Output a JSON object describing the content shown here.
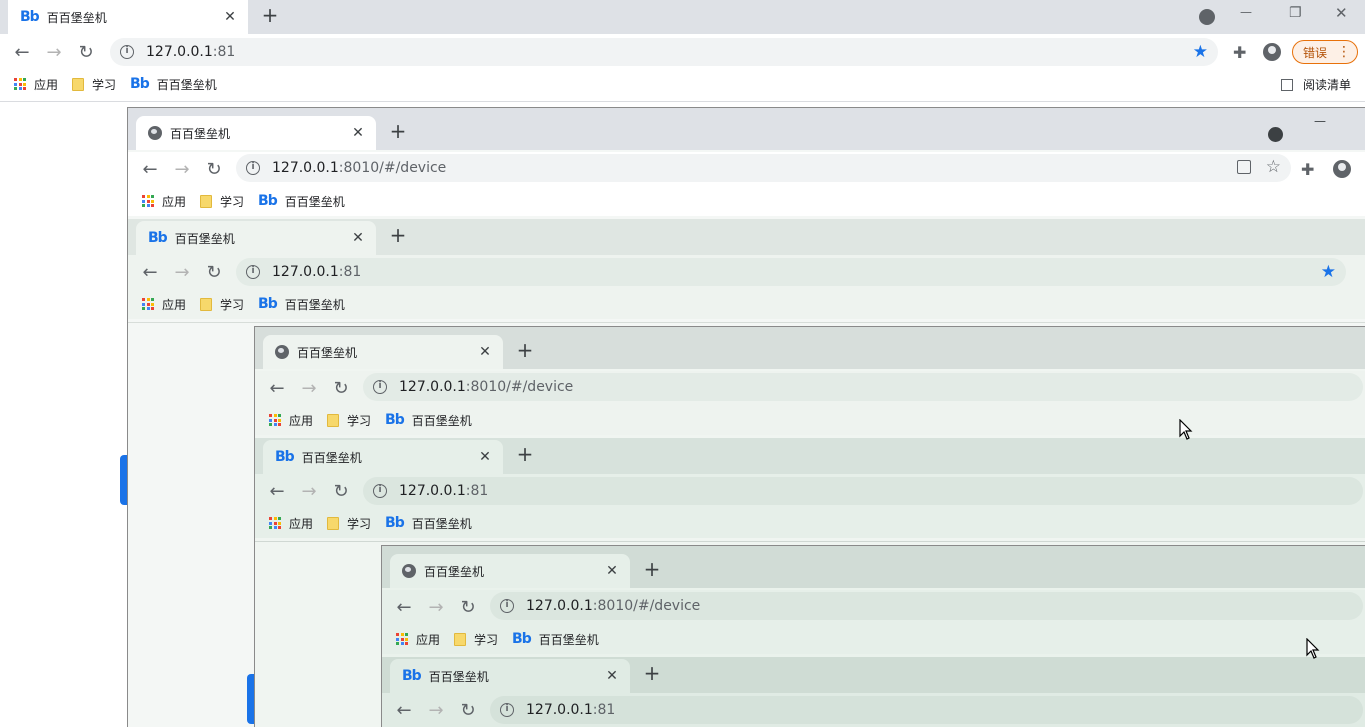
{
  "outer": {
    "tab_title": "百百堡垒机",
    "url_host": "127.0.0.1",
    "url_rest": ":81",
    "profile_button": "错误",
    "bookmarks": [
      {
        "label": "应用",
        "icon": "apps-icon"
      },
      {
        "label": "学习",
        "icon": "folder-icon"
      },
      {
        "label": "百百堡垒机",
        "icon": "bb-icon"
      }
    ],
    "reading_list": "阅读清单",
    "window_controls": {
      "minimize": "—",
      "restore": "❐",
      "close": "✕"
    }
  },
  "nested": {
    "device_tab_title": "百百堡垒机",
    "device_url_host": "127.0.0.1",
    "device_url_rest": ":8010/#/device",
    "app_tab_title": "百百堡垒机",
    "app_url_host": "127.0.0.1",
    "app_url_rest": ":81",
    "bookmarks": [
      {
        "label": "应用"
      },
      {
        "label": "学习"
      },
      {
        "label": "百百堡垒机"
      }
    ]
  },
  "icons": {
    "close": "✕",
    "new_tab": "+",
    "back": "←",
    "forward": "→",
    "reload": "↻",
    "star": "★",
    "star_outline": "☆",
    "puzzle": "✚",
    "info": "i",
    "menu_dots": "⋮"
  },
  "colors": {
    "accent": "#1a73e8",
    "profile_border": "#e8710a"
  }
}
